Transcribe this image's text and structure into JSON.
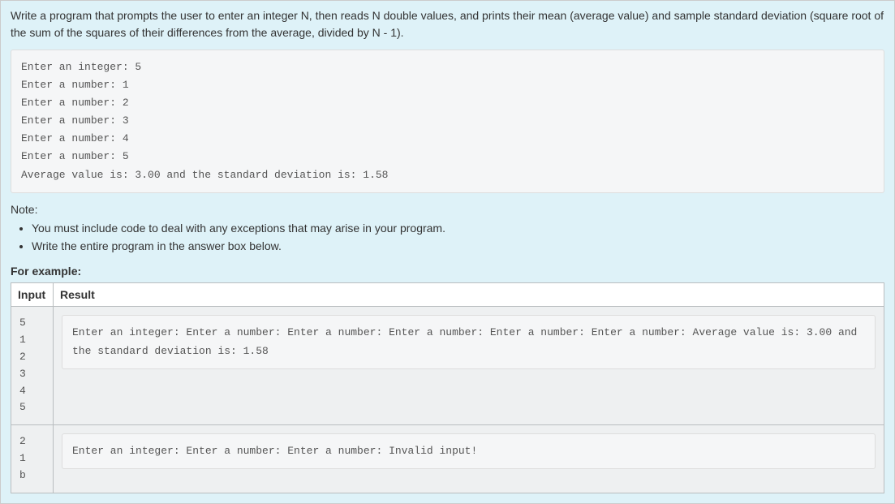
{
  "prompt": "Write a program that prompts the user to enter an integer N, then reads N double values, and prints their mean (average value) and sample standard deviation (square root of the sum of the squares of their differences from the average, divided by N - 1).",
  "sample_output": "Enter an integer: 5\nEnter a number: 1\nEnter a number: 2\nEnter a number: 3\nEnter a number: 4\nEnter a number: 5\nAverage value is: 3.00 and the standard deviation is: 1.58",
  "note_label": "Note:",
  "notes": [
    "You must include code to deal with any exceptions that may arise in your program.",
    "Write the entire program in the answer box below."
  ],
  "example_label": "For example:",
  "table": {
    "headers": {
      "input": "Input",
      "result": "Result"
    },
    "rows": [
      {
        "input": "5\n1\n2\n3\n4\n5",
        "result": "Enter an integer: Enter a number: Enter a number: Enter a number: Enter a number: Enter a number: Average value is: 3.00 and the standard deviation is: 1.58"
      },
      {
        "input": "2\n1\nb",
        "result": "Enter an integer: Enter a number: Enter a number: Invalid input!"
      }
    ]
  }
}
